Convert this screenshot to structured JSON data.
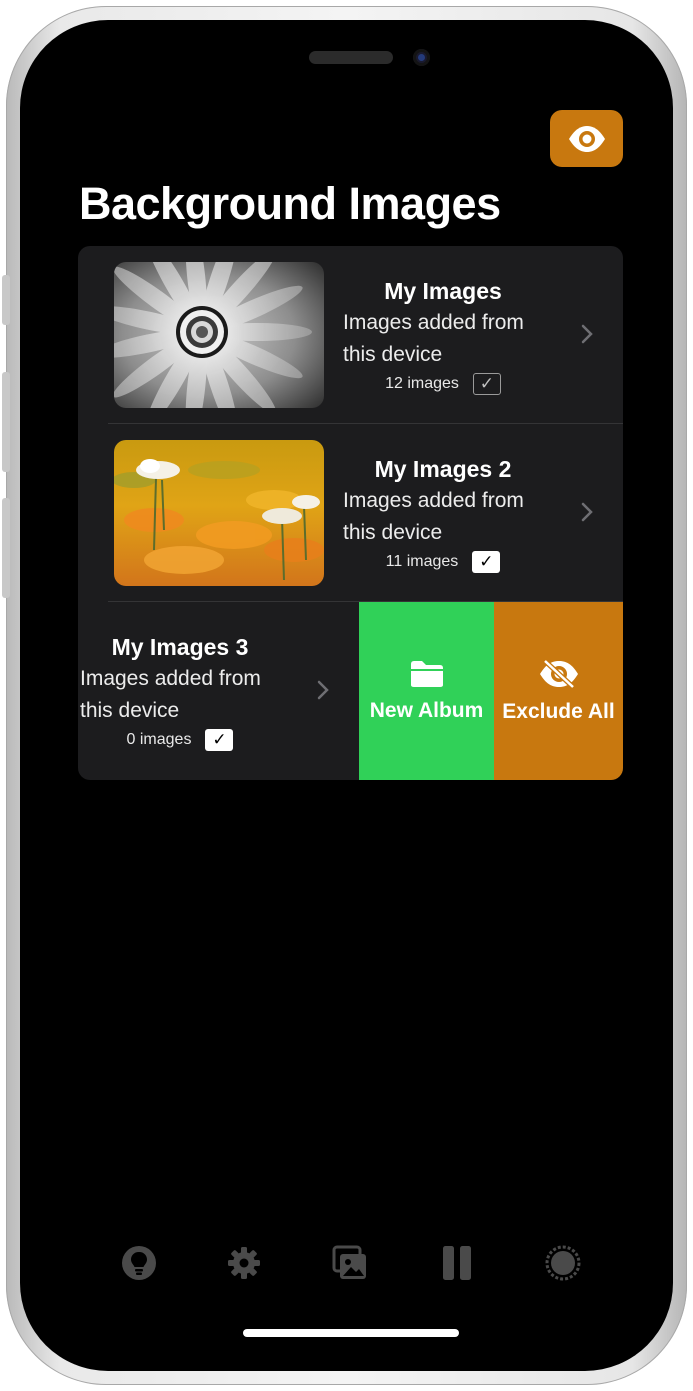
{
  "header": {
    "title": "Background Images",
    "visibility_button_icon": "eye-icon",
    "accent_color": "#c8780f"
  },
  "albums": [
    {
      "name": "My Images",
      "description": "Images added from this device",
      "count": "12 images",
      "included": true,
      "thumbnail": "white-daisy-monochrome"
    },
    {
      "name": "My Images 2",
      "description": "Images added from this device",
      "count": "11 images",
      "included": true,
      "thumbnail": "poppy-field-orange"
    },
    {
      "name": "My Images 3",
      "description": "Images added from this device",
      "count": "0 images",
      "included": true
    }
  ],
  "swipe_actions": {
    "new_album": {
      "label": "New Album",
      "icon": "folder-icon",
      "color": "#30d158"
    },
    "exclude_all": {
      "label": "Exclude All",
      "icon": "eye-slash-icon",
      "color": "#c8780f"
    }
  },
  "tab_bar": {
    "items": [
      "lightbulb-icon",
      "gear-icon",
      "photos-icon",
      "pause-icon",
      "aperture-icon"
    ],
    "color": "#4a4a4a"
  }
}
